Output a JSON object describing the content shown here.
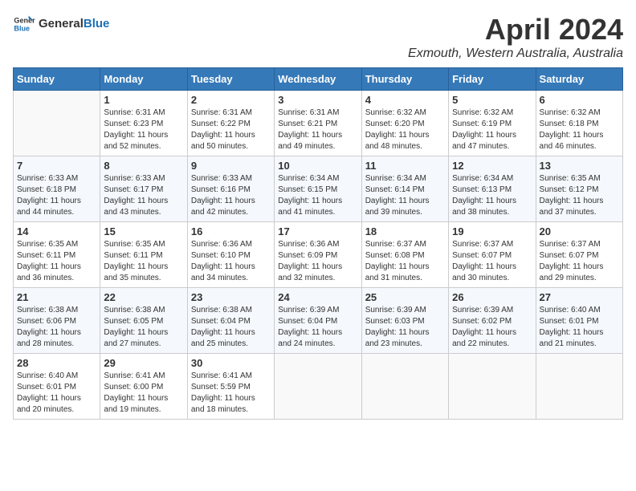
{
  "header": {
    "logo_general": "General",
    "logo_blue": "Blue",
    "month": "April 2024",
    "location": "Exmouth, Western Australia, Australia"
  },
  "weekdays": [
    "Sunday",
    "Monday",
    "Tuesday",
    "Wednesday",
    "Thursday",
    "Friday",
    "Saturday"
  ],
  "weeks": [
    [
      {
        "day": "",
        "info": ""
      },
      {
        "day": "1",
        "info": "Sunrise: 6:31 AM\nSunset: 6:23 PM\nDaylight: 11 hours\nand 52 minutes."
      },
      {
        "day": "2",
        "info": "Sunrise: 6:31 AM\nSunset: 6:22 PM\nDaylight: 11 hours\nand 50 minutes."
      },
      {
        "day": "3",
        "info": "Sunrise: 6:31 AM\nSunset: 6:21 PM\nDaylight: 11 hours\nand 49 minutes."
      },
      {
        "day": "4",
        "info": "Sunrise: 6:32 AM\nSunset: 6:20 PM\nDaylight: 11 hours\nand 48 minutes."
      },
      {
        "day": "5",
        "info": "Sunrise: 6:32 AM\nSunset: 6:19 PM\nDaylight: 11 hours\nand 47 minutes."
      },
      {
        "day": "6",
        "info": "Sunrise: 6:32 AM\nSunset: 6:18 PM\nDaylight: 11 hours\nand 46 minutes."
      }
    ],
    [
      {
        "day": "7",
        "info": "Sunrise: 6:33 AM\nSunset: 6:18 PM\nDaylight: 11 hours\nand 44 minutes."
      },
      {
        "day": "8",
        "info": "Sunrise: 6:33 AM\nSunset: 6:17 PM\nDaylight: 11 hours\nand 43 minutes."
      },
      {
        "day": "9",
        "info": "Sunrise: 6:33 AM\nSunset: 6:16 PM\nDaylight: 11 hours\nand 42 minutes."
      },
      {
        "day": "10",
        "info": "Sunrise: 6:34 AM\nSunset: 6:15 PM\nDaylight: 11 hours\nand 41 minutes."
      },
      {
        "day": "11",
        "info": "Sunrise: 6:34 AM\nSunset: 6:14 PM\nDaylight: 11 hours\nand 39 minutes."
      },
      {
        "day": "12",
        "info": "Sunrise: 6:34 AM\nSunset: 6:13 PM\nDaylight: 11 hours\nand 38 minutes."
      },
      {
        "day": "13",
        "info": "Sunrise: 6:35 AM\nSunset: 6:12 PM\nDaylight: 11 hours\nand 37 minutes."
      }
    ],
    [
      {
        "day": "14",
        "info": "Sunrise: 6:35 AM\nSunset: 6:11 PM\nDaylight: 11 hours\nand 36 minutes."
      },
      {
        "day": "15",
        "info": "Sunrise: 6:35 AM\nSunset: 6:11 PM\nDaylight: 11 hours\nand 35 minutes."
      },
      {
        "day": "16",
        "info": "Sunrise: 6:36 AM\nSunset: 6:10 PM\nDaylight: 11 hours\nand 34 minutes."
      },
      {
        "day": "17",
        "info": "Sunrise: 6:36 AM\nSunset: 6:09 PM\nDaylight: 11 hours\nand 32 minutes."
      },
      {
        "day": "18",
        "info": "Sunrise: 6:37 AM\nSunset: 6:08 PM\nDaylight: 11 hours\nand 31 minutes."
      },
      {
        "day": "19",
        "info": "Sunrise: 6:37 AM\nSunset: 6:07 PM\nDaylight: 11 hours\nand 30 minutes."
      },
      {
        "day": "20",
        "info": "Sunrise: 6:37 AM\nSunset: 6:07 PM\nDaylight: 11 hours\nand 29 minutes."
      }
    ],
    [
      {
        "day": "21",
        "info": "Sunrise: 6:38 AM\nSunset: 6:06 PM\nDaylight: 11 hours\nand 28 minutes."
      },
      {
        "day": "22",
        "info": "Sunrise: 6:38 AM\nSunset: 6:05 PM\nDaylight: 11 hours\nand 27 minutes."
      },
      {
        "day": "23",
        "info": "Sunrise: 6:38 AM\nSunset: 6:04 PM\nDaylight: 11 hours\nand 25 minutes."
      },
      {
        "day": "24",
        "info": "Sunrise: 6:39 AM\nSunset: 6:04 PM\nDaylight: 11 hours\nand 24 minutes."
      },
      {
        "day": "25",
        "info": "Sunrise: 6:39 AM\nSunset: 6:03 PM\nDaylight: 11 hours\nand 23 minutes."
      },
      {
        "day": "26",
        "info": "Sunrise: 6:39 AM\nSunset: 6:02 PM\nDaylight: 11 hours\nand 22 minutes."
      },
      {
        "day": "27",
        "info": "Sunrise: 6:40 AM\nSunset: 6:01 PM\nDaylight: 11 hours\nand 21 minutes."
      }
    ],
    [
      {
        "day": "28",
        "info": "Sunrise: 6:40 AM\nSunset: 6:01 PM\nDaylight: 11 hours\nand 20 minutes."
      },
      {
        "day": "29",
        "info": "Sunrise: 6:41 AM\nSunset: 6:00 PM\nDaylight: 11 hours\nand 19 minutes."
      },
      {
        "day": "30",
        "info": "Sunrise: 6:41 AM\nSunset: 5:59 PM\nDaylight: 11 hours\nand 18 minutes."
      },
      {
        "day": "",
        "info": ""
      },
      {
        "day": "",
        "info": ""
      },
      {
        "day": "",
        "info": ""
      },
      {
        "day": "",
        "info": ""
      }
    ]
  ]
}
